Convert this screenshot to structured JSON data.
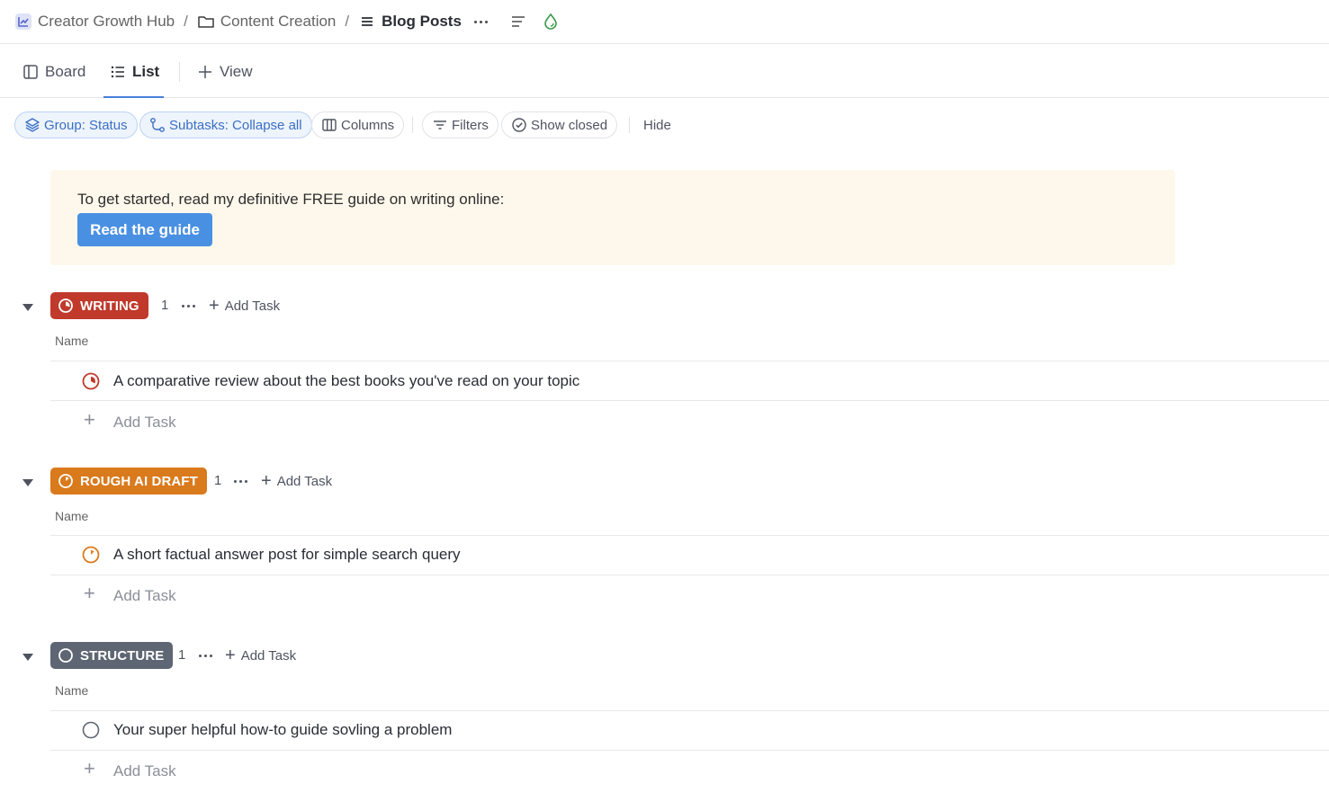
{
  "breadcrumb": {
    "space": "Creator Growth Hub",
    "folder": "Content Creation",
    "list": "Blog Posts",
    "separator": "/"
  },
  "views": {
    "tabs": [
      {
        "label": "Board",
        "icon": "board-icon",
        "active": false
      },
      {
        "label": "List",
        "icon": "list-icon",
        "active": true
      }
    ],
    "add_view_label": "View"
  },
  "toolbar": {
    "group": "Group: Status",
    "subtasks": "Subtasks: Collapse all",
    "columns": "Columns",
    "filters": "Filters",
    "show_closed": "Show closed",
    "hide": "Hide"
  },
  "banner": {
    "text": "To get started, read my definitive FREE guide on writing online:",
    "button": "Read the guide"
  },
  "groups": [
    {
      "status": "WRITING",
      "color": "#c0392b",
      "count": "1",
      "add_task": "Add Task",
      "column": "Name",
      "tasks": [
        {
          "name": "A comparative review about the best books you've read on your topic"
        }
      ],
      "add_row": "Add Task"
    },
    {
      "status": "ROUGH AI DRAFT",
      "color": "#d97a1c",
      "count": "1",
      "add_task": "Add Task",
      "column": "Name",
      "tasks": [
        {
          "name": "A short factual answer post for simple search query"
        }
      ],
      "add_row": "Add Task"
    },
    {
      "status": "STRUCTURE",
      "color": "#5f6673",
      "count": "1",
      "add_task": "Add Task",
      "column": "Name",
      "tasks": [
        {
          "name": "Your super helpful how-to guide sovling a problem"
        }
      ],
      "add_row": "Add Task"
    }
  ],
  "colors": {
    "accent": "#4a90e2",
    "banner_bg": "#fdf8eb",
    "active_tab": "#4a7fd8"
  }
}
